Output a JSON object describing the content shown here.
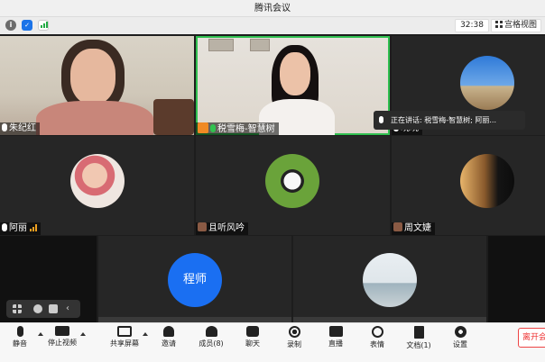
{
  "window": {
    "title": "腾讯会议"
  },
  "status": {
    "info_icon": "info-icon",
    "security_icon": "shield-icon",
    "signal_icon": "signal-icon",
    "timer": "32:38",
    "grid_view_label": "宫格视图"
  },
  "tooltip": {
    "speaking": "正在讲话: 税雪梅-智慧树; 阿丽..."
  },
  "participants": {
    "p1": "朱纪红",
    "p2": "税雪梅-智慧树",
    "p3": "晓晓",
    "p4": "阿丽",
    "p5": "且听风吟",
    "p6": "周文婕",
    "p7": "程师"
  },
  "toolbar": {
    "mute": "静音",
    "stop_video": "停止视频",
    "share_screen": "共享屏幕",
    "invite": "邀请",
    "members": "成员(8)",
    "chat": "聊天",
    "record": "录制",
    "live": "直播",
    "reactions": "表情",
    "docs": "文档(1)",
    "settings": "设置",
    "leave": "离开会"
  },
  "colors": {
    "speaking_border": "#2fbf4f",
    "avatar_blue": "#1a6ff2",
    "leave_red": "#e33333"
  }
}
